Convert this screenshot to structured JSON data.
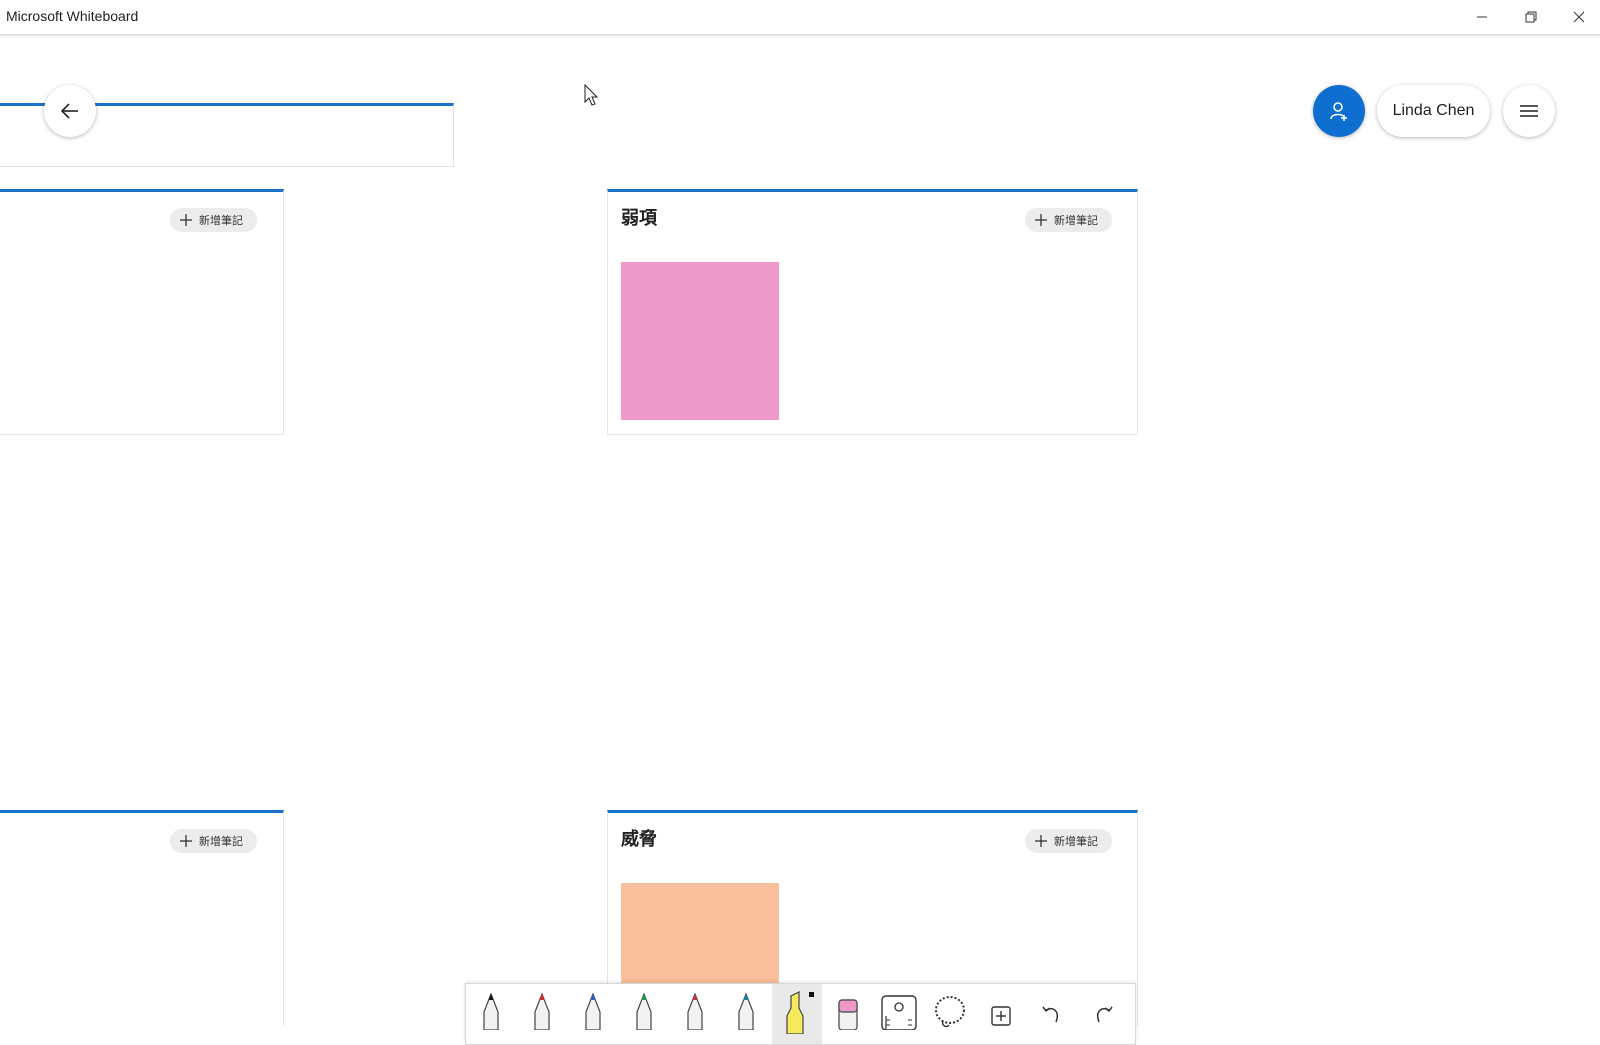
{
  "window": {
    "title": "Microsoft Whiteboard"
  },
  "header": {
    "user_name": "Linda Chen"
  },
  "panels": [
    {
      "title": "",
      "add_note_label": "新增筆記"
    },
    {
      "title": "弱項",
      "add_note_label": "新增筆記",
      "note_color": "#ed99c9"
    },
    {
      "title": "",
      "add_note_label": "新增筆記"
    },
    {
      "title": "威脅",
      "add_note_label": "新增筆記",
      "note_color": "#f9bf9d"
    }
  ],
  "toolbar": {
    "tools": [
      {
        "name": "pen-black",
        "color": "#111111"
      },
      {
        "name": "pen-red",
        "color": "#d42a2a"
      },
      {
        "name": "pen-blue",
        "color": "#2a62c9"
      },
      {
        "name": "pen-green",
        "color": "#1f9c4a"
      },
      {
        "name": "pen-red-2",
        "color": "#c8323a"
      },
      {
        "name": "pen-teal",
        "color": "#1b7fa8"
      },
      {
        "name": "highlighter-yellow",
        "color": "#f4ea5b",
        "active": true
      },
      {
        "name": "eraser",
        "color": "#ef9ac4"
      },
      {
        "name": "ruler-icon"
      },
      {
        "name": "lasso-icon"
      },
      {
        "name": "insert-icon"
      },
      {
        "name": "undo-icon"
      },
      {
        "name": "redo-icon"
      }
    ]
  },
  "colors": {
    "accent": "#1a73c9",
    "share_button": "#0f6fd1"
  }
}
